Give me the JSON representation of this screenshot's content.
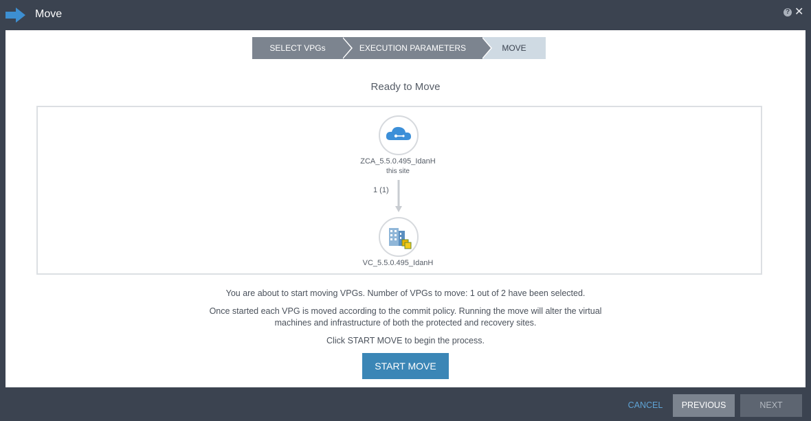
{
  "window": {
    "title": "Move",
    "help_glyph": "?",
    "close_glyph": "✕"
  },
  "wizard": {
    "steps": [
      {
        "label": "SELECT VPGs",
        "state": "done"
      },
      {
        "label": "EXECUTION PARAMETERS",
        "state": "done"
      },
      {
        "label": "MOVE",
        "state": "active"
      }
    ]
  },
  "main": {
    "heading": "Ready to Move",
    "source": {
      "name": "ZCA_5.5.0.495_IdanH",
      "subtitle": "this site",
      "icon": "azure-cloud-icon"
    },
    "vpg_count": "1 (1)",
    "target": {
      "name": "VC_5.5.0.495_IdanH",
      "icon": "vcenter-building-icon"
    },
    "message_1": "You are about to start moving VPGs. Number of VPGs to move: 1 out of 2 have been selected.",
    "message_2_line_1": "Once started each VPG is moved according to the commit policy. Running the move will alter the virtual",
    "message_2_line_2": "machines and infrastructure of both the protected and recovery sites.",
    "message_3": "Click START MOVE to begin the process.",
    "start_button": "START MOVE"
  },
  "footer": {
    "cancel": "CANCEL",
    "previous": "PREVIOUS",
    "next": "NEXT"
  },
  "colors": {
    "accent": "#3b86b6",
    "header_bg": "#3b4350",
    "step_done": "#7c848f",
    "step_active": "#cfdae3",
    "link": "#5fa4d6"
  }
}
